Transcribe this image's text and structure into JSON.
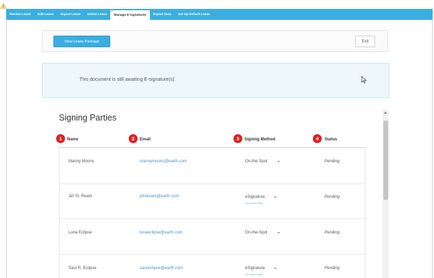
{
  "nav": {
    "tabs": [
      {
        "label": "Review Lease",
        "active": false
      },
      {
        "label": "Edit Lease",
        "active": false
      },
      {
        "label": "Import Lease",
        "active": false
      },
      {
        "label": "Delete Lease",
        "active": false
      },
      {
        "label": "Manage E-signatures",
        "active": true
      },
      {
        "label": "Export Data",
        "active": false
      },
      {
        "label": "Set Up Default Lease",
        "active": false
      }
    ]
  },
  "toolbar": {
    "view_package_label": "View Lease Package",
    "exit_label": "Exit"
  },
  "alert": {
    "message": "This document is still awaiting E-signature(s).",
    "icon": "warning-icon"
  },
  "signing": {
    "title": "Signing Parties",
    "columns": [
      {
        "number": "1",
        "label": "Name"
      },
      {
        "number": "2",
        "label": "Email"
      },
      {
        "number": "3",
        "label": "Signing Method"
      },
      {
        "number": "4",
        "label": "Status"
      }
    ],
    "rows": [
      {
        "name": "Manny Moons",
        "email": "mannymoons@earth.com",
        "method": "On-the-Spot",
        "resend": "",
        "status": "Pending"
      },
      {
        "name": "Jet St. Ream",
        "email": "jetstream@earth.com",
        "method": "eSignature",
        "resend": "(1) resend email",
        "status": "Pending"
      },
      {
        "name": "Luna Eclipse",
        "email": "lunaeclipse@earth.com",
        "method": "On-the-Spot",
        "resend": "",
        "status": "Pending"
      },
      {
        "name": "Saul R. Eclipse",
        "email": "saureclipse@earth.com",
        "method": "eSignature",
        "resend": "(1) resend email",
        "status": "Pending"
      }
    ]
  },
  "colors": {
    "accent": "#3aaee0",
    "badge": "#e02020",
    "link": "#4a90c8",
    "alert_bg": "#eef8fb"
  }
}
